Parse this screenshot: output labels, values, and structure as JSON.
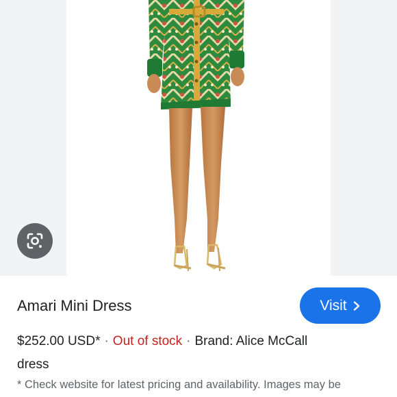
{
  "product": {
    "title": "Amari Mini Dress",
    "price": "$252.00 USD*",
    "separator": "·",
    "stock_status": "Out of stock",
    "brand_text": "Brand: Alice McCall",
    "brand_continuation": "dress",
    "note": "* Check website for latest pricing and availability. Images may be"
  },
  "actions": {
    "visit_label": "Visit"
  },
  "icons": {
    "lens": "google-lens-icon",
    "visit_chevron": "chevron-right-icon"
  },
  "colors": {
    "accent": "#1a73e8",
    "out_of_stock": "#c5221f",
    "lens_button": "#5f6368",
    "image_backdrop": "#f1f3f4"
  }
}
